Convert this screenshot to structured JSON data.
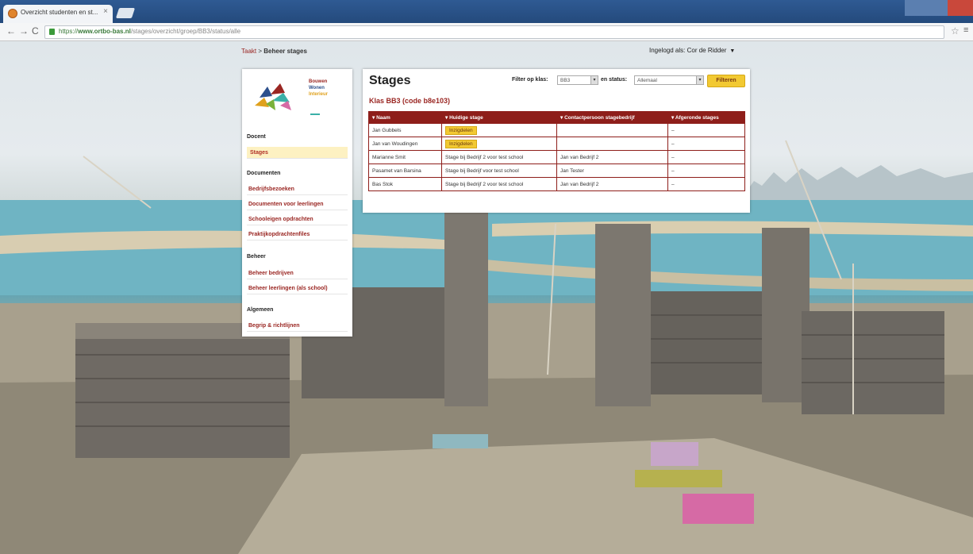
{
  "browser": {
    "tab_title": "Overzicht studenten en st...",
    "tab_close": "×",
    "url_secure": "https://",
    "url_host": "www.ortbo-bas.nl",
    "url_path": "/stages/overzicht/groep/BB3/status/alle",
    "star_icon": "☆",
    "menu_icon": "≡"
  },
  "breadcrumb": {
    "home": "Taakt",
    "separator": " > ",
    "current": "Beheer stages"
  },
  "login": {
    "text": "Ingelogd als: Cor de Ridder"
  },
  "sidebar": {
    "logo": {
      "line1": "Bouwen",
      "line2": "Wonen",
      "line3": "Interieur"
    },
    "sections": [
      {
        "heading": "Docent",
        "items": [
          {
            "label": "Stages",
            "active": true
          }
        ]
      },
      {
        "heading": "Documenten",
        "items": [
          {
            "label": "Bedrijfsbezoeken"
          },
          {
            "label": "Documenten voor leerlingen"
          },
          {
            "label": "Schooleigen opdrachten"
          },
          {
            "label": "Praktijkopdrachtenfiles"
          }
        ]
      },
      {
        "heading": "Beheer",
        "items": [
          {
            "label": "Beheer bedrijven"
          },
          {
            "label": "Beheer leerlingen (als school)"
          }
        ]
      },
      {
        "heading": "Algemeen",
        "items": [
          {
            "label": "Begrip & richtlijnen"
          }
        ]
      }
    ]
  },
  "main": {
    "title": "Stages",
    "subtitle": "Klas BB3 (code b8e103)",
    "filter": {
      "class_label": "Filter op klas:",
      "class_value": "BB3",
      "status_label": "en status:",
      "status_value": "Allemaal",
      "button": "Filteren"
    },
    "table": {
      "headers": [
        "▾ Naam",
        "▾ Huidige stage",
        "▾ Contactpersoon stagebedrijf",
        "▾ Afgeronde stages"
      ],
      "rows": [
        {
          "name": "Jan Gubbels",
          "stage": "Inzigdelen",
          "stage_badge": true,
          "contact": "",
          "completed": "–"
        },
        {
          "name": "Jan van Woudingen",
          "stage": "Inzigdelen",
          "stage_badge": true,
          "contact": "",
          "completed": "–"
        },
        {
          "name": "Marianne Smit",
          "stage": "Stage bij Bedrijf 2 voor test school",
          "stage_badge": false,
          "contact": "Jan van Bedrijf 2",
          "completed": "–"
        },
        {
          "name": "Pasamet van Barsina",
          "stage": "Stage bij Bedrijf voor test school",
          "stage_badge": false,
          "contact": "Jan Tester",
          "completed": "–"
        },
        {
          "name": "Bas Stok",
          "stage": "Stage bij Bedrijf 2 voor test school",
          "stage_badge": false,
          "contact": "Jan van Bedrijf 2",
          "completed": "–"
        }
      ]
    }
  },
  "colors": {
    "accent": "#8e1e1a",
    "highlight": "#f2c932",
    "link": "#9a2622"
  }
}
